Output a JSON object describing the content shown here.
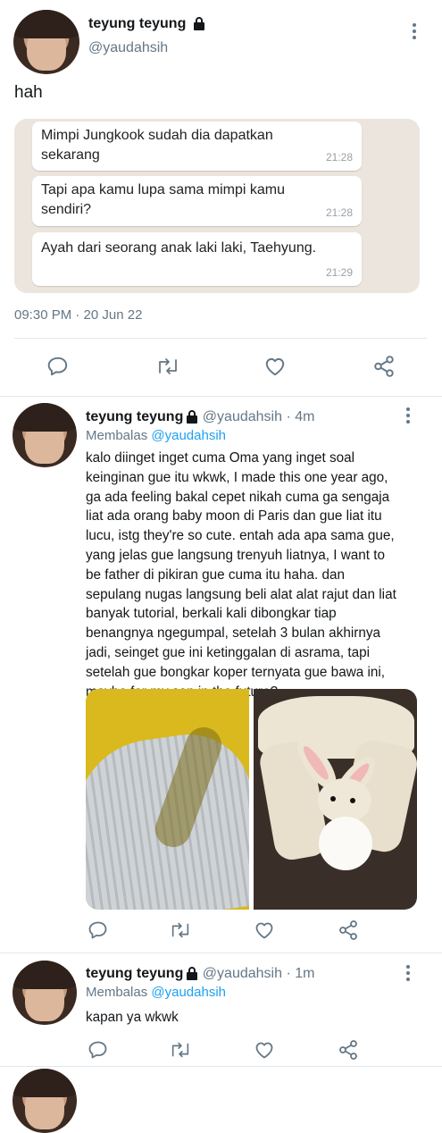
{
  "main_tweet": {
    "display_name": "teyung teyung",
    "handle": "@yaudahsih",
    "text": "hah",
    "timestamp": "09:30 PM · 20 Jun 22",
    "chat_messages": [
      {
        "text": "Mimpi Jungkook sudah dia dapatkan sekarang",
        "time": "21:28"
      },
      {
        "text": "Tapi apa kamu lupa sama mimpi kamu sendiri?",
        "time": "21:28"
      },
      {
        "text": "Ayah dari seorang anak laki laki, Taehyung.",
        "time": "21:29"
      }
    ]
  },
  "reply1": {
    "display_name": "teyung teyung",
    "handle": "@yaudahsih",
    "age": "· 4m",
    "replying_prefix": "Membalas",
    "replying_to": "@yaudahsih",
    "text": "kalo diinget inget cuma Oma yang inget soal keinginan gue itu wkwk, I made this one year ago, ga ada feeling bakal cepet nikah cuma ga sengaja liat ada orang baby moon di Paris dan gue liat itu lucu, istg they're so cute. entah ada apa sama gue, yang jelas gue langsung trenyuh liatnya, I want to be father di pikiran gue cuma itu haha. dan sepulang nugas langsung beli alat alat rajut dan liat banyak tutorial, berkali kali dibongkar tiap benangnya ngegumpal, setelah 3 bulan akhirnya jadi, seinget gue ini ketinggalan di asrama, tapi setelah gue bongkar koper ternyata gue bawa ini, maybe for my son in the future?"
  },
  "reply2": {
    "display_name": "teyung teyung",
    "handle": "@yaudahsih",
    "age": "· 1m",
    "replying_prefix": "Membalas",
    "replying_to": "@yaudahsih",
    "text": "kapan ya wkwk"
  },
  "colors": {
    "link": "#1da1f2",
    "muted": "#657786",
    "divider": "#e1e8ed",
    "chat_bg": "#ece5dd"
  }
}
